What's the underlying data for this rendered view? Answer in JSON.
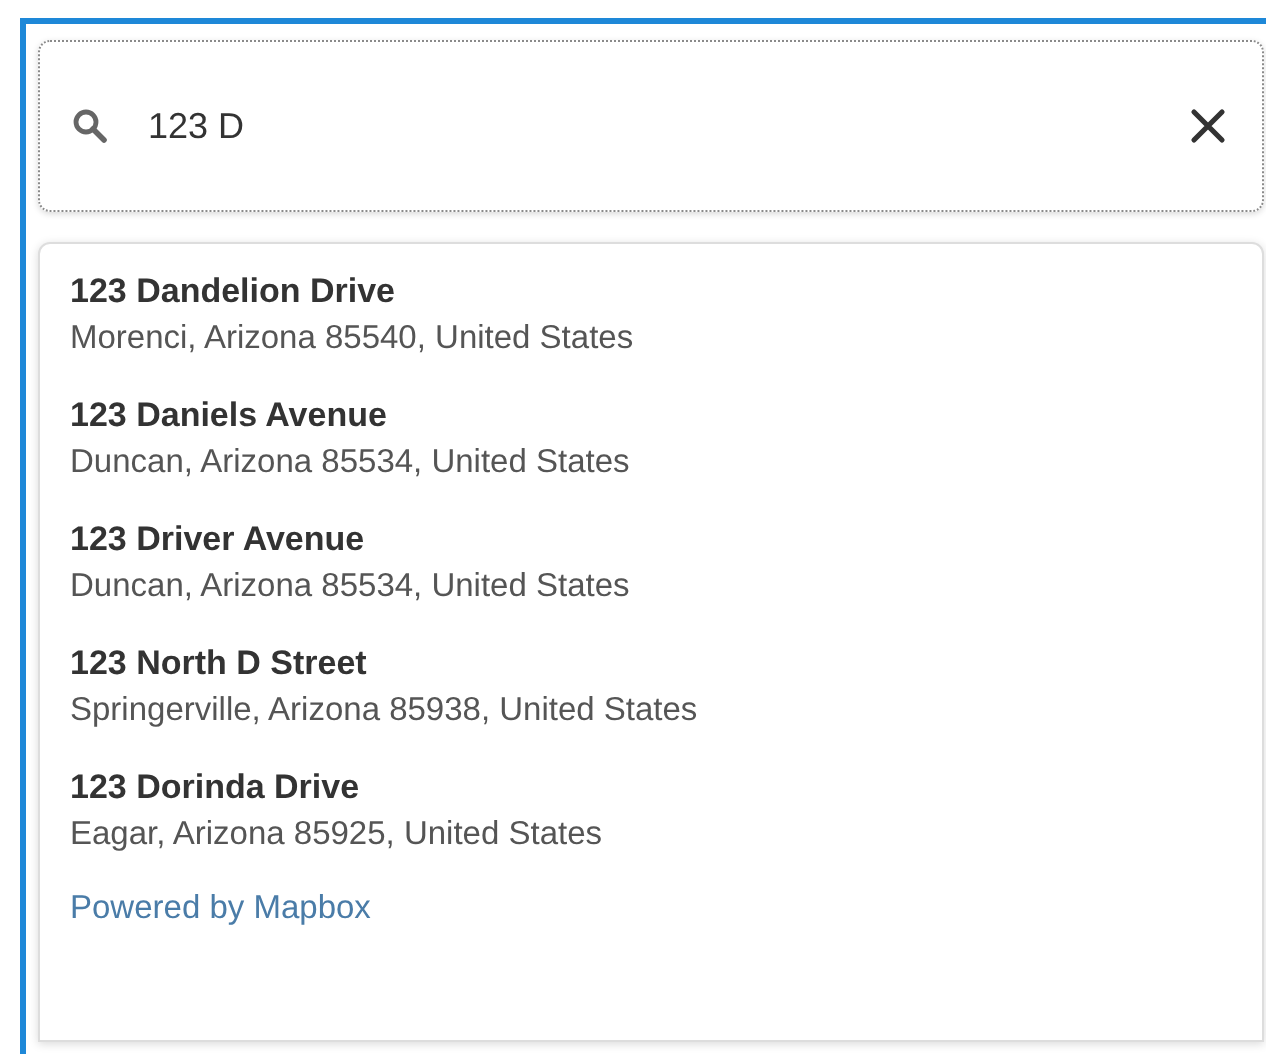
{
  "search": {
    "value": "123 D"
  },
  "results": [
    {
      "title": "123 Dandelion Drive",
      "address": "Morenci, Arizona 85540, United States"
    },
    {
      "title": "123 Daniels Avenue",
      "address": "Duncan, Arizona 85534, United States"
    },
    {
      "title": "123 Driver Avenue",
      "address": "Duncan, Arizona 85534, United States"
    },
    {
      "title": "123 North D Street",
      "address": "Springerville, Arizona 85938, United States"
    },
    {
      "title": "123 Dorinda Drive",
      "address": "Eagar, Arizona 85925, United States"
    }
  ],
  "footer": "Powered by Mapbox"
}
